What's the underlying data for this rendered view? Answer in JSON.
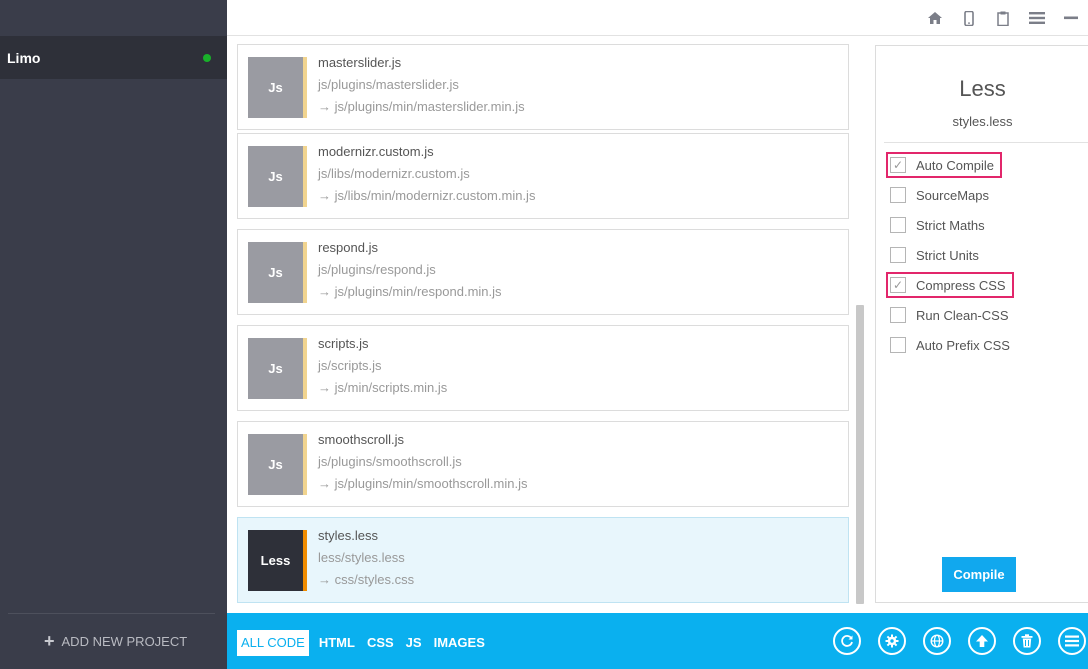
{
  "sidebar": {
    "project_name": "Limo",
    "add_project_label": "ADD NEW PROJECT",
    "status_color": "#19b02a"
  },
  "topbar": {
    "icons": [
      "home-icon",
      "mobile-icon",
      "clipboard-icon",
      "menu-icon",
      "minimize-icon"
    ]
  },
  "files": [
    {
      "name": "masterslider.js",
      "path": "js/plugins/masterslider.js",
      "output": "→ js/plugins/min/masterslider.min.js",
      "type": "Js",
      "active": false
    },
    {
      "name": "modernizr.custom.js",
      "path": "js/libs/modernizr.custom.js",
      "output": "→ js/libs/min/modernizr.custom.min.js",
      "type": "Js",
      "active": false
    },
    {
      "name": "respond.js",
      "path": "js/plugins/respond.js",
      "output": "→ js/plugins/min/respond.min.js",
      "type": "Js",
      "active": false
    },
    {
      "name": "scripts.js",
      "path": "js/scripts.js",
      "output": "→ js/min/scripts.min.js",
      "type": "Js",
      "active": false
    },
    {
      "name": "smoothscroll.js",
      "path": "js/plugins/smoothscroll.js",
      "output": "→ js/plugins/min/smoothscroll.min.js",
      "type": "Js",
      "active": false
    },
    {
      "name": "styles.less",
      "path": "less/styles.less",
      "output": "→ css/styles.css",
      "type": "Less",
      "active": true
    }
  ],
  "panel": {
    "title": "Less",
    "file": "styles.less",
    "options": [
      {
        "label": "Auto Compile",
        "checked": true,
        "highlighted": true
      },
      {
        "label": "SourceMaps",
        "checked": false,
        "highlighted": false
      },
      {
        "label": "Strict Maths",
        "checked": false,
        "highlighted": false
      },
      {
        "label": "Strict Units",
        "checked": false,
        "highlighted": false
      },
      {
        "label": "Compress CSS",
        "checked": true,
        "highlighted": true
      },
      {
        "label": "Run Clean-CSS",
        "checked": false,
        "highlighted": false
      },
      {
        "label": "Auto Prefix CSS",
        "checked": false,
        "highlighted": false
      }
    ],
    "compile_label": "Compile"
  },
  "bottombar": {
    "tabs": [
      {
        "label": "ALL CODE",
        "active": true
      },
      {
        "label": "HTML",
        "active": false
      },
      {
        "label": "CSS",
        "active": false
      },
      {
        "label": "JS",
        "active": false
      },
      {
        "label": "IMAGES",
        "active": false
      }
    ],
    "actions": [
      "refresh-icon",
      "settings-icon",
      "globe-icon",
      "upload-icon",
      "trash-icon",
      "menu-icon"
    ]
  },
  "colors": {
    "accent": "#0ab0ef",
    "sidebar": "#3a3d4a",
    "highlight": "#e2266b",
    "less_stripe": "#f08c00",
    "js_stripe": "#f1d48f"
  }
}
